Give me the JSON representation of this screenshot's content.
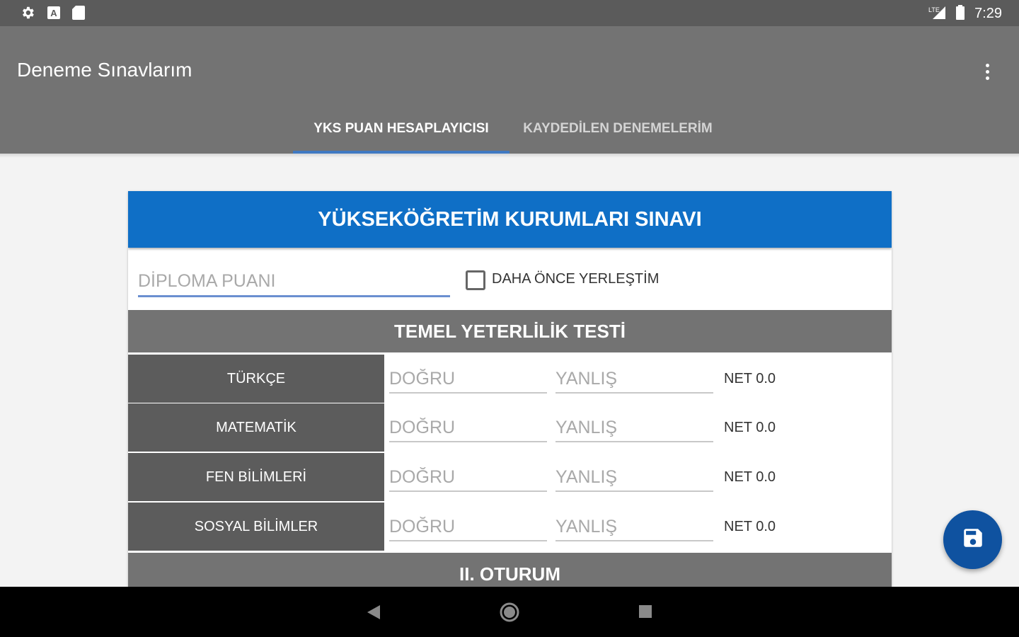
{
  "status_bar": {
    "time": "7:29",
    "left_icons": [
      "settings-icon",
      "a-icon",
      "sd-card-icon"
    ],
    "right_icons": [
      "signal-icon",
      "battery-icon"
    ]
  },
  "app_bar": {
    "title": "Deneme Sınavlarım",
    "overflow_icon": "more-vert-icon"
  },
  "tabs": [
    {
      "label": "YKS PUAN HESAPLAYICISI",
      "active": true
    },
    {
      "label": "KAYDEDİLEN DENEMELERİM",
      "active": false
    }
  ],
  "card": {
    "title": "YÜKSEKÖĞRETİM KURUMLARI SINAVI",
    "diploma": {
      "placeholder": "DİPLOMA PUANI",
      "value": ""
    },
    "checkbox": {
      "label": "DAHA ÖNCE YERLEŞTİM",
      "checked": false
    },
    "sections": [
      {
        "title": "TEMEL YETERLİLİK TESTİ",
        "rows": [
          {
            "label": "TÜRKÇE",
            "correct_placeholder": "DOĞRU",
            "wrong_placeholder": "YANLIŞ",
            "net": "NET 0.0"
          },
          {
            "label": "MATEMATİK",
            "correct_placeholder": "DOĞRU",
            "wrong_placeholder": "YANLIŞ",
            "net": "NET 0.0"
          },
          {
            "label": "FEN BİLİMLERİ",
            "correct_placeholder": "DOĞRU",
            "wrong_placeholder": "YANLIŞ",
            "net": "NET 0.0"
          },
          {
            "label": "SOSYAL BİLİMLER",
            "correct_placeholder": "DOĞRU",
            "wrong_placeholder": "YANLIŞ",
            "net": "NET 0.0"
          }
        ]
      },
      {
        "title": "II. OTURUM"
      }
    ]
  },
  "fab": {
    "icon": "save-icon"
  },
  "nav_bar": {
    "icons": [
      "back-icon",
      "home-icon",
      "recents-icon"
    ]
  },
  "colors": {
    "status_bar": "#5b5b5b",
    "app_bar": "#737373",
    "tab_indicator": "#3f79c2",
    "card_header": "#0f6fc6",
    "section_bar": "#737373",
    "row_label": "#5c5c5c",
    "fab": "#0f52a0"
  }
}
